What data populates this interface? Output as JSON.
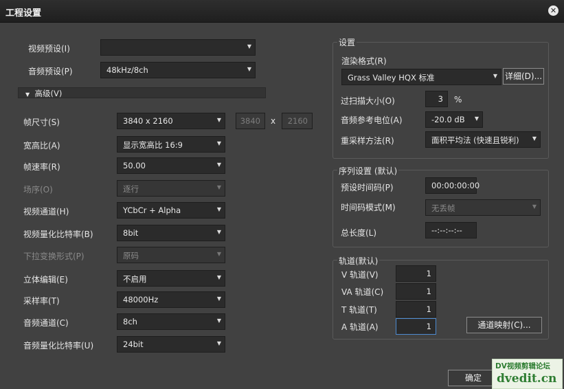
{
  "window": {
    "title": "工程设置",
    "close_icon": "close-icon"
  },
  "preset": {
    "video_label": "视频预设(I)",
    "video_value": "",
    "audio_label": "音频预设(P)",
    "audio_value": "48kHz/8ch",
    "advanced_label": "高级(V)"
  },
  "advanced": {
    "frame_size_label": "帧尺寸(S)",
    "frame_size_value": "3840 x 2160",
    "width_value": "3840",
    "x_label": "x",
    "height_value": "2160",
    "aspect_label": "宽高比(A)",
    "aspect_value": "显示宽高比 16:9",
    "framerate_label": "帧速率(R)",
    "framerate_value": "50.00",
    "field_label": "场序(O)",
    "field_value": "逐行",
    "channel_label": "视频通道(H)",
    "channel_value": "YCbCr + Alpha",
    "bitdepth_label": "视频量化比特率(B)",
    "bitdepth_value": "8bit",
    "pulldown_label": "下拉变换形式(P)",
    "pulldown_value": "原码",
    "stereo_label": "立体编辑(E)",
    "stereo_value": "不启用",
    "samplerate_label": "采样率(T)",
    "samplerate_value": "48000Hz",
    "audio_channel_label": "音频通道(C)",
    "audio_channel_value": "8ch",
    "audio_bitdepth_label": "音频量化比特率(U)",
    "audio_bitdepth_value": "24bit"
  },
  "settings": {
    "group_title": "设置",
    "render_format_label": "渲染格式(R)",
    "render_format_value": "Grass Valley HQX 标准",
    "detail_button": "详细(D)...",
    "overscan_label": "过扫描大小(O)",
    "overscan_value": "3",
    "overscan_unit": "%",
    "audio_ref_label": "音频参考电位(A)",
    "audio_ref_value": "-20.0 dB",
    "resample_label": "重采样方法(R)",
    "resample_value": "面积平均法 (快速且锐利)"
  },
  "sequence": {
    "group_title": "序列设置 (默认)",
    "timecode_label": "预设时间码(P)",
    "timecode_value": "00:00:00:00",
    "tc_mode_label": "时间码模式(M)",
    "tc_mode_value": "无丢帧",
    "length_label": "总长度(L)",
    "length_value": "--:--:--:--"
  },
  "tracks": {
    "group_title": "轨道(默认)",
    "v_label": "V 轨道(V)",
    "v_value": "1",
    "va_label": "VA 轨道(C)",
    "va_value": "1",
    "t_label": "T 轨道(T)",
    "t_value": "1",
    "a_label": "A 轨道(A)",
    "a_value": "1",
    "map_button": "通道映射(C)..."
  },
  "footer": {
    "ok_button": "确定"
  },
  "watermark": {
    "line1": "DV视频剪辑论坛",
    "line2": "dvedit.cn"
  },
  "colors": {
    "bg": "#414141",
    "titlebar": "#1f1f1f",
    "focus": "#4d8ad0",
    "watermark": "#2e7d32"
  }
}
